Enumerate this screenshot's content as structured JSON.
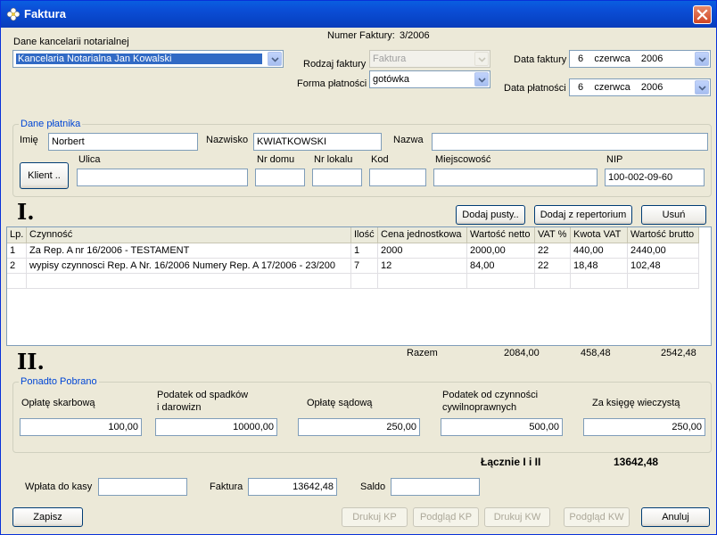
{
  "window": {
    "title": "Faktura"
  },
  "header": {
    "kancelaria_label": "Dane kancelarii notarialnej",
    "kancelaria_value": "Kancelaria Notarialna Jan Kowalski",
    "numer_label": "Numer Faktury:",
    "numer_value": "3/2006",
    "rodzaj_label": "Rodzaj faktury",
    "rodzaj_value": "Faktura",
    "forma_label": "Forma płatności",
    "forma_value": "gotówka",
    "data_faktury_label": "Data faktury",
    "data_faktury_value": "6    czerwca    2006",
    "data_platnosci_label": "Data płatności",
    "data_platnosci_value": "6    czerwca    2006"
  },
  "platnik": {
    "legend": "Dane płatnika",
    "imie_label": "Imię",
    "imie_value": "Norbert",
    "nazwisko_label": "Nazwisko",
    "nazwisko_value": "KWIATKOWSKI",
    "nazwa_label": "Nazwa",
    "nazwa_value": "",
    "klient_button": "Klient ..",
    "ulica_label": "Ulica",
    "ulica_value": "",
    "nrdomu_label": "Nr domu",
    "nrdomu_value": "",
    "nrlokalu_label": "Nr lokalu",
    "nrlokalu_value": "",
    "kod_label": "Kod",
    "kod_value": "",
    "miejscowosc_label": "Miejscowość",
    "miejscowosc_value": "",
    "nip_label": "NIP",
    "nip_value": "100-002-09-60"
  },
  "section1": {
    "roman": "I.",
    "add_empty_button": "Dodaj pusty..",
    "add_repertorium_button": "Dodaj z repertorium",
    "remove_button": "Usuń",
    "columns": [
      "Lp.",
      "Czynność",
      "Ilość",
      "Cena jednostkowa",
      "Wartość netto",
      "VAT %",
      "Kwota VAT",
      "Wartość brutto"
    ],
    "rows": [
      [
        "1",
        "Za Rep. A nr 16/2006 - TESTAMENT",
        "1",
        "2000",
        "2000,00",
        "22",
        "440,00",
        "2440,00"
      ],
      [
        "2",
        "wypisy czynnosci Rep. A Nr. 16/2006 Numery Rep. A 17/2006 - 23/200",
        "7",
        "12",
        "84,00",
        "22",
        "18,48",
        "102,48"
      ]
    ],
    "razem_label": "Razem",
    "razem_netto": "2084,00",
    "razem_vat": "458,48",
    "razem_brutto": "2542,48"
  },
  "section2": {
    "roman": "II.",
    "legend": "Ponadto Pobrano",
    "skarbowa_label": "Opłatę skarbową",
    "skarbowa_value": "100,00",
    "spadki_label_1": "Podatek od spadków",
    "spadki_label_2": "i darowizn",
    "spadki_value": "10000,00",
    "sadowa_label": "Opłatę sądową",
    "sadowa_value": "250,00",
    "cywil_label_1": "Podatek od czynności",
    "cywil_label_2": "cywilnoprawnych",
    "cywil_value": "500,00",
    "ksiega_label": "Za księgę wieczystą",
    "ksiega_value": "250,00"
  },
  "totals": {
    "lacznie_label": "Łącznie I i II",
    "lacznie_value": "13642,48",
    "wplata_label": "Wpłata do kasy",
    "wplata_value": "",
    "faktura_label": "Faktura",
    "faktura_value": "13642,48",
    "saldo_label": "Saldo",
    "saldo_value": ""
  },
  "footer": {
    "save_button": "Zapisz",
    "druk_kp_button": "Drukuj KP",
    "podglad_kp_button": "Podgląd KP",
    "druk_kw_button": "Drukuj KW",
    "podglad_kw_button": "Podgląd KW",
    "cancel_button": "Anuluj"
  },
  "colors": {
    "titlebar": "#0A5FE0",
    "legend": "#0046D5",
    "selection": "#316AC5",
    "face": "#ECE9D8"
  }
}
